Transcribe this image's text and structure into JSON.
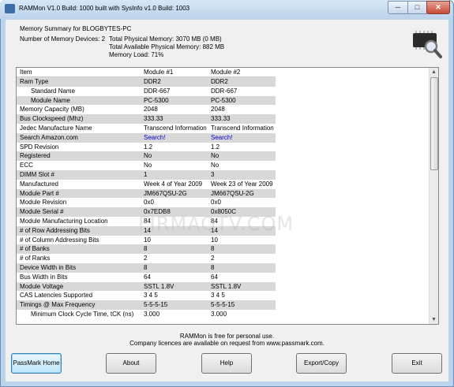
{
  "window": {
    "title": "RAMMon V1.0 Build: 1000 built with SysInfo v1.0 Build: 1003",
    "controls": {
      "minimize": "─",
      "maximize": "□",
      "close": "✕"
    }
  },
  "summary": {
    "title": "Memory Summary for BLOGBYTES-PC",
    "devices": "Number of Memory Devices: 2",
    "physical": "Total Physical Memory: 3070 MB (0 MB)",
    "available": "Total Available Physical Memory: 882 MB",
    "load": "Memory Load: 71%"
  },
  "grid": {
    "columns": [
      "Item",
      "Module #1",
      "Module #2"
    ],
    "rows": [
      {
        "item": "Ram Type",
        "m1": "DDR2",
        "m2": "DDR2",
        "indent": false,
        "alt": true
      },
      {
        "item": "Standard Name",
        "m1": "DDR-667",
        "m2": "DDR-667",
        "indent": true,
        "alt": false
      },
      {
        "item": "Module Name",
        "m1": "PC-5300",
        "m2": "PC-5300",
        "indent": true,
        "alt": true
      },
      {
        "item": "Memory Capacity (MB)",
        "m1": "2048",
        "m2": "2048",
        "indent": false,
        "alt": false
      },
      {
        "item": "Bus Clockspeed (Mhz)",
        "m1": "333.33",
        "m2": "333.33",
        "indent": false,
        "alt": true
      },
      {
        "item": "Jedec Manufacture Name",
        "m1": "Transcend Information",
        "m2": "Transcend Information",
        "indent": false,
        "alt": false
      },
      {
        "item": "Search Amazon.com",
        "m1": "Search!",
        "m2": "Search!",
        "indent": false,
        "alt": true,
        "link": true
      },
      {
        "item": "SPD Revision",
        "m1": "1.2",
        "m2": "1.2",
        "indent": false,
        "alt": false
      },
      {
        "item": "Registered",
        "m1": "No",
        "m2": "No",
        "indent": false,
        "alt": true
      },
      {
        "item": "ECC",
        "m1": "No",
        "m2": "No",
        "indent": false,
        "alt": false
      },
      {
        "item": "DIMM Slot #",
        "m1": "1",
        "m2": "3",
        "indent": false,
        "alt": true
      },
      {
        "item": "Manufactured",
        "m1": "Week 4 of Year 2009",
        "m2": "Week 23 of Year 2009",
        "indent": false,
        "alt": false
      },
      {
        "item": "Module Part #",
        "m1": "JM667QSU-2G",
        "m2": "JM667QSU-2G",
        "indent": false,
        "alt": true
      },
      {
        "item": "Module Revision",
        "m1": "0x0",
        "m2": "0x0",
        "indent": false,
        "alt": false
      },
      {
        "item": "Module Serial #",
        "m1": "0x7EDB8",
        "m2": "0x8050C",
        "indent": false,
        "alt": true
      },
      {
        "item": "Module Manufacturing Location",
        "m1": "84",
        "m2": "84",
        "indent": false,
        "alt": false
      },
      {
        "item": "# of Row Addressing Bits",
        "m1": "14",
        "m2": "14",
        "indent": false,
        "alt": true
      },
      {
        "item": "# of Column Addressing Bits",
        "m1": "10",
        "m2": "10",
        "indent": false,
        "alt": false
      },
      {
        "item": "# of Banks",
        "m1": "8",
        "m2": "8",
        "indent": false,
        "alt": true
      },
      {
        "item": "# of Ranks",
        "m1": "2",
        "m2": "2",
        "indent": false,
        "alt": false
      },
      {
        "item": "Device Width in Bits",
        "m1": "8",
        "m2": "8",
        "indent": false,
        "alt": true
      },
      {
        "item": "Bus Width in Bits",
        "m1": "64",
        "m2": "64",
        "indent": false,
        "alt": false
      },
      {
        "item": "Module Voltage",
        "m1": "SSTL 1.8V",
        "m2": "SSTL 1.8V",
        "indent": false,
        "alt": true
      },
      {
        "item": "CAS Latencies Supported",
        "m1": "3 4 5",
        "m2": "3 4 5",
        "indent": false,
        "alt": false
      },
      {
        "item": "Timings @ Max Frequency",
        "m1": "5-5-5-15",
        "m2": "5-5-5-15",
        "indent": false,
        "alt": true
      },
      {
        "item": "Minimum Clock Cycle Time, tCK (ns)",
        "m1": "3.000",
        "m2": "3.000",
        "indent": true,
        "alt": false
      }
    ]
  },
  "footer": {
    "line1": "RAMMon is free for personal use.",
    "line2": "Company licences are available on request from www.passmark.com."
  },
  "buttons": {
    "home": "PassMark Home",
    "about": "About",
    "help": "Help",
    "export": "Export/Copy",
    "exit": "Exit"
  },
  "watermark": "FIRMAQTV.COM",
  "colors": {
    "link": "#0000cc",
    "alt_row": "#d8d8d8",
    "title_bar": "#bcd3ec"
  },
  "icons": [
    "memory-chip-magnifier-icon"
  ]
}
